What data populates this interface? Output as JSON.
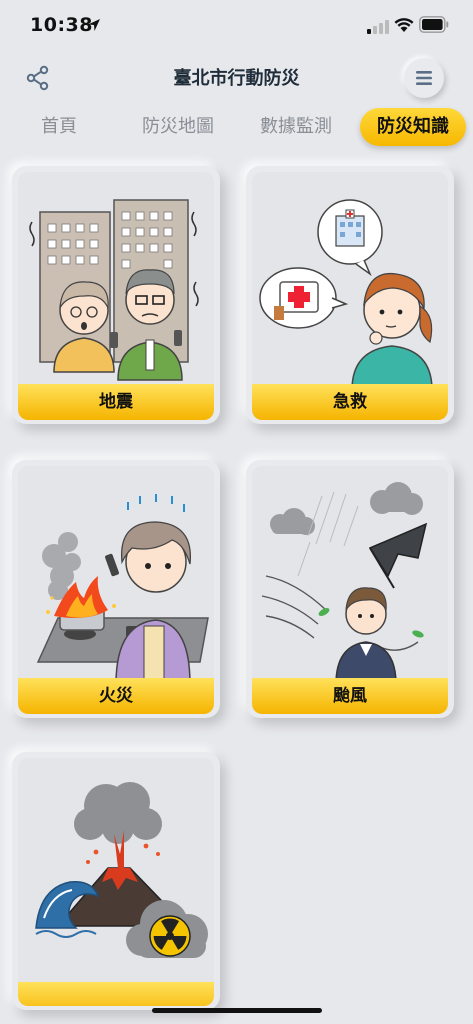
{
  "status_bar": {
    "time": "10:38"
  },
  "header": {
    "title": "臺北市行動防災"
  },
  "tabs": [
    {
      "label": "首頁",
      "active": false
    },
    {
      "label": "防災地圖",
      "active": false
    },
    {
      "label": "數據監測",
      "active": false
    },
    {
      "label": "防災知識",
      "active": true
    }
  ],
  "cards": [
    {
      "label": "地震",
      "icon": "earthquake-illustration"
    },
    {
      "label": "急救",
      "icon": "first-aid-illustration"
    },
    {
      "label": "火災",
      "icon": "fire-illustration"
    },
    {
      "label": "颱風",
      "icon": "typhoon-illustration"
    },
    {
      "label": "",
      "icon": "volcano-nuclear-illustration"
    }
  ],
  "colors": {
    "accent": "#f6b800",
    "background": "#e7e8ec",
    "title": "#1f2d3a"
  }
}
